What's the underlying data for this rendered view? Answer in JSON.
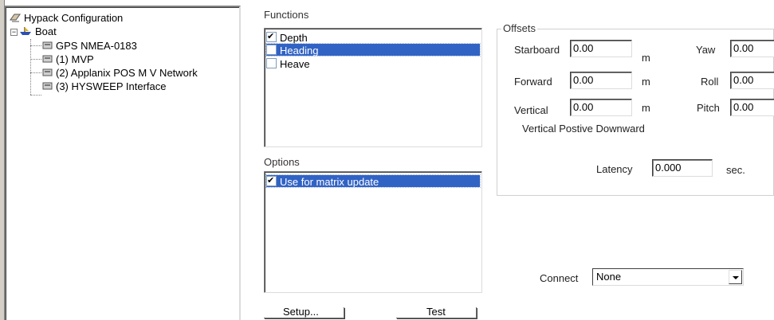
{
  "tree": {
    "root_label": "Hypack Configuration",
    "boat_label": "Boat",
    "devices": [
      "GPS NMEA-0183",
      "(1) MVP",
      "(2) Applanix POS M V Network",
      "(3) HYSWEEP Interface"
    ]
  },
  "functions": {
    "label": "Functions",
    "items": [
      {
        "label": "Depth",
        "checked": true
      },
      {
        "label": "Heading",
        "checked": false
      },
      {
        "label": "Heave",
        "checked": false
      }
    ]
  },
  "options": {
    "label": "Options",
    "items": [
      {
        "label": "Use for matrix update",
        "checked": true
      }
    ]
  },
  "offsets": {
    "title": "Offsets",
    "starboard_label": "Starboard",
    "starboard_value": "0.00",
    "forward_label": "Forward",
    "forward_value": "0.00",
    "vertical_label": "Vertical",
    "vertical_value": "0.00",
    "unit": "m",
    "yaw_label": "Yaw",
    "yaw_value": "0.00",
    "roll_label": "Roll",
    "roll_value": "0.00",
    "pitch_label": "Pitch",
    "pitch_value": "0.00",
    "note": "Vertical Postive Downward",
    "latency_label": "Latency",
    "latency_value": "0.000",
    "latency_unit": "sec."
  },
  "connect": {
    "label": "Connect",
    "value": "None"
  },
  "buttons": {
    "setup": "Setup...",
    "test": "Test"
  },
  "colors": {
    "selection": "#3163c5"
  }
}
